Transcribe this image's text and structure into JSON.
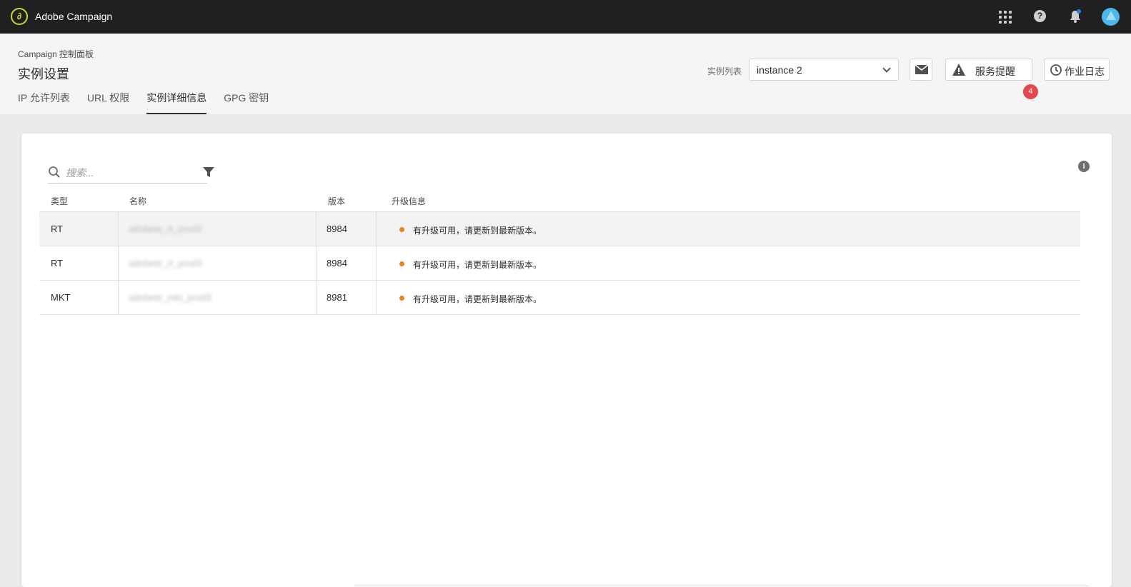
{
  "topbar": {
    "app_title": "Adobe Campaign",
    "logo_icon": "adobe-campaign-logo",
    "icons": [
      "apps-grid-icon",
      "help-icon",
      "bell-icon",
      "avatar"
    ],
    "help_glyph": "?"
  },
  "header": {
    "breadcrumb": "Campaign 控制面板",
    "breadcrumb_chevron": "›",
    "title": "实例设置",
    "tabs": [
      {
        "label": "IP 允许列表",
        "active": false
      },
      {
        "label": "URL 权限",
        "active": false
      },
      {
        "label": "实例详细信息",
        "active": true
      },
      {
        "label": "GPG 密钥",
        "active": false
      }
    ],
    "instance_label": "实例列表",
    "instance_value": "instance 2",
    "alerts_label": "服务提醒",
    "alerts_count": "4",
    "log_label": "作业日志"
  },
  "main": {
    "search_placeholder": "搜索...",
    "info_glyph": "i",
    "columns": [
      "类型",
      "名称",
      "版本",
      "升级信息"
    ],
    "rows": [
      {
        "type": "RT",
        "name": "adobete_rt_prod2",
        "version": "8984",
        "upgrade": "有升级可用，请更新到最新版本。"
      },
      {
        "type": "RT",
        "name": "adobete_rt_prod3",
        "version": "8984",
        "upgrade": "有升级可用，请更新到最新版本。"
      },
      {
        "type": "MKT",
        "name": "adobete_mkt_prod3",
        "version": "8981",
        "upgrade": "有升级可用，请更新到最新版本。"
      }
    ]
  },
  "colors": {
    "topbar": "#202020",
    "status_dot": "#e68619",
    "badge": "#e34850",
    "avatar": "#4cb7e8"
  }
}
